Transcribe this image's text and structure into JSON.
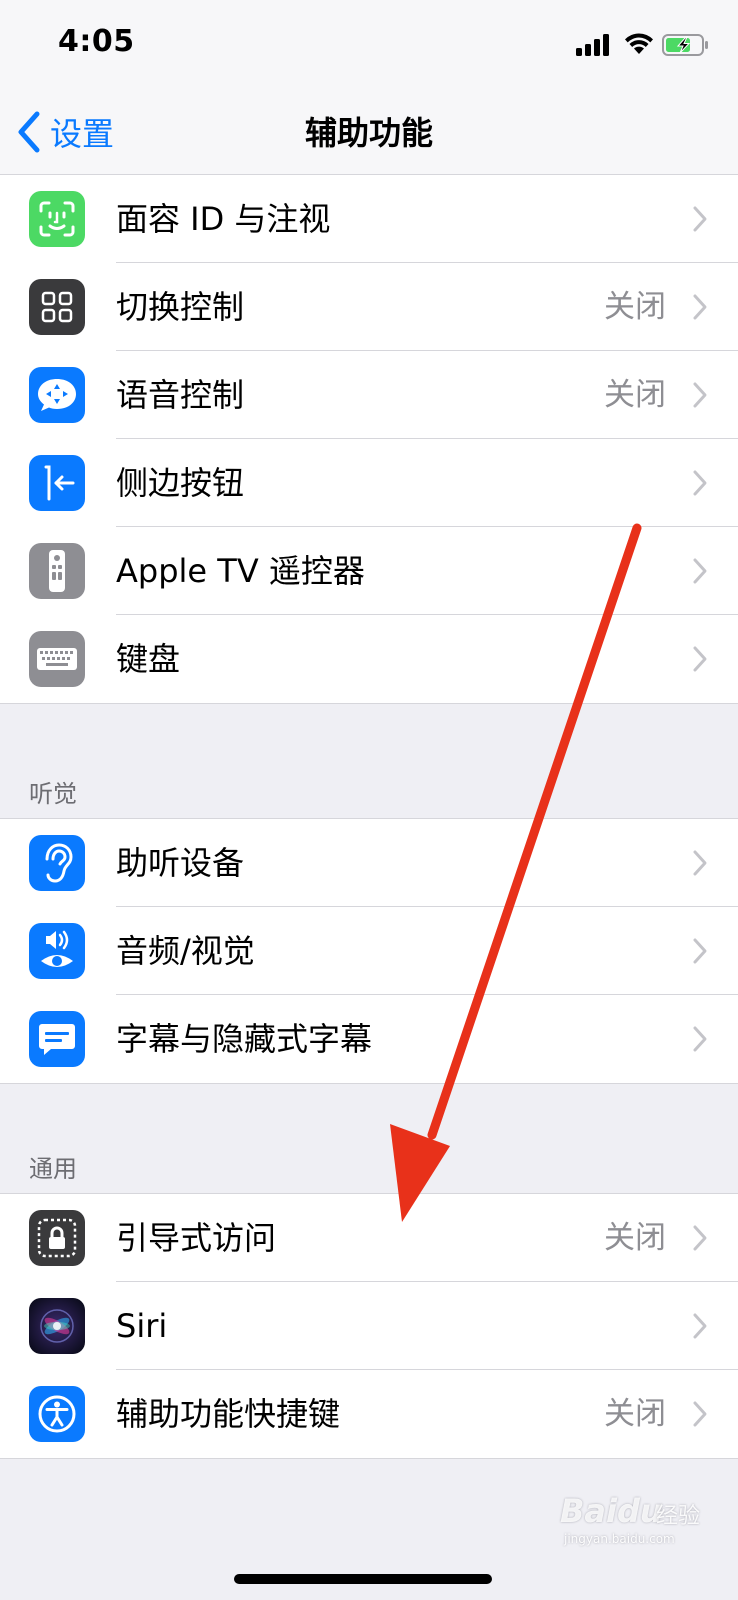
{
  "status_bar": {
    "time": "4:05"
  },
  "nav": {
    "back_label": "设置",
    "title": "辅助功能"
  },
  "groups": [
    {
      "header": "",
      "items": [
        {
          "label": "面容 ID 与注视",
          "value": "",
          "icon": "face-id-icon",
          "icon_color": "#4cd964"
        },
        {
          "label": "切换控制",
          "value": "关闭",
          "icon": "switch-control-icon",
          "icon_color": "#3a3a3c"
        },
        {
          "label": "语音控制",
          "value": "关闭",
          "icon": "voice-control-icon",
          "icon_color": "#0a7aff"
        },
        {
          "label": "侧边按钮",
          "value": "",
          "icon": "side-button-icon",
          "icon_color": "#0a7aff"
        },
        {
          "label": "Apple TV 遥控器",
          "value": "",
          "icon": "apple-tv-remote-icon",
          "icon_color": "#8e8e93"
        },
        {
          "label": "键盘",
          "value": "",
          "icon": "keyboard-icon",
          "icon_color": "#8e8e93"
        }
      ]
    },
    {
      "header": "听觉",
      "items": [
        {
          "label": "助听设备",
          "value": "",
          "icon": "hearing-devices-icon",
          "icon_color": "#0a7aff"
        },
        {
          "label": "音频/视觉",
          "value": "",
          "icon": "audio-visual-icon",
          "icon_color": "#0a7aff"
        },
        {
          "label": "字幕与隐藏式字幕",
          "value": "",
          "icon": "subtitles-captioning-icon",
          "icon_color": "#0a7aff"
        }
      ]
    },
    {
      "header": "通用",
      "items": [
        {
          "label": "引导式访问",
          "value": "关闭",
          "icon": "guided-access-icon",
          "icon_color": "#3a3a3c"
        },
        {
          "label": "Siri",
          "value": "",
          "icon": "siri-icon",
          "icon_color": "#1b1b3a"
        },
        {
          "label": "辅助功能快捷键",
          "value": "关闭",
          "icon": "accessibility-shortcut-icon",
          "icon_color": "#0a7aff"
        }
      ]
    }
  ],
  "annotation": {
    "arrow_color": "#e8311a"
  },
  "watermark": {
    "logo": "Baidu",
    "name": "经验",
    "url": "jingyan.baidu.com"
  }
}
